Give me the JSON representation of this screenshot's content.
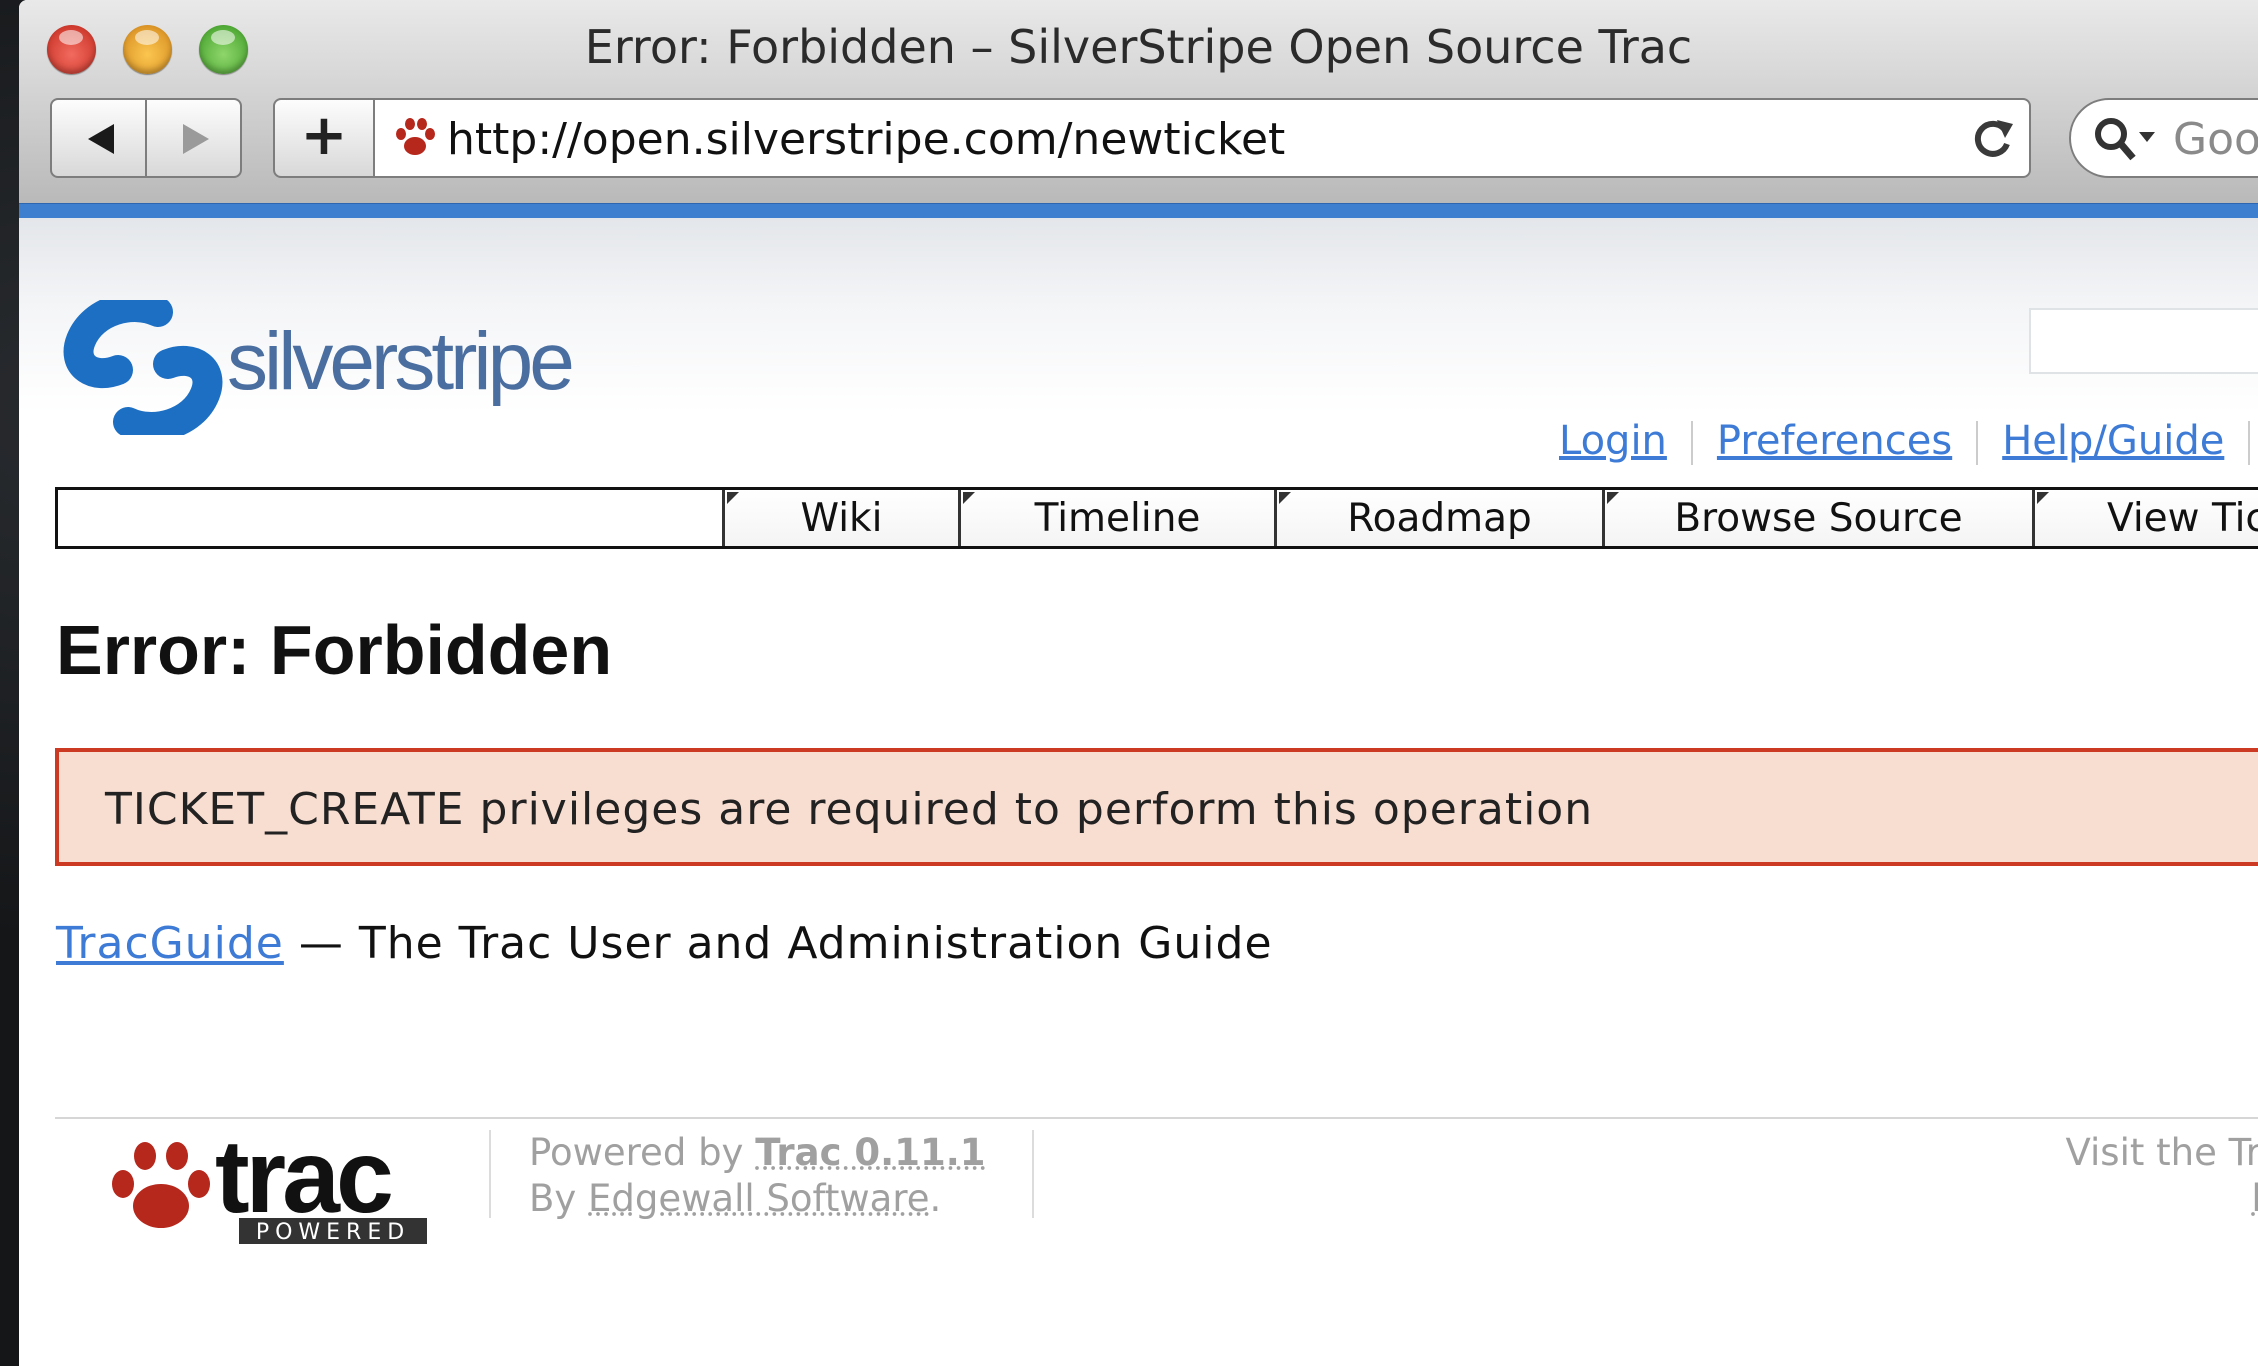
{
  "browser": {
    "window_title": "Error: Forbidden – SilverStripe Open Source Trac",
    "url": "http://open.silverstripe.com/newticket",
    "search_placeholder": "Goo"
  },
  "site": {
    "logo_text": "silverstripe",
    "metanav": [
      "Login",
      "Preferences",
      "Help/Guide"
    ],
    "mainnav": [
      "Wiki",
      "Timeline",
      "Roadmap",
      "Browse Source",
      "View Tick"
    ]
  },
  "content": {
    "title": "Error: Forbidden",
    "error_message": "TICKET_CREATE privileges are required to perform this operation",
    "guide_link": "TracGuide",
    "guide_rest": " — The Trac User and Administration Guide"
  },
  "footer": {
    "trac_word": "trac",
    "trac_badge": "POWERED",
    "powered_by": "Powered by ",
    "trac_version": "Trac 0.11.1",
    "by": "By ",
    "edgewall": "Edgewall Software",
    "period": ".",
    "visit_line1": "Visit the Trac",
    "visit_line2": "htt"
  },
  "colors": {
    "accent_blue": "#3f7fd0",
    "link": "#3d7bd6",
    "error_border": "#cd3a23",
    "error_bg": "#f8ddd1"
  }
}
